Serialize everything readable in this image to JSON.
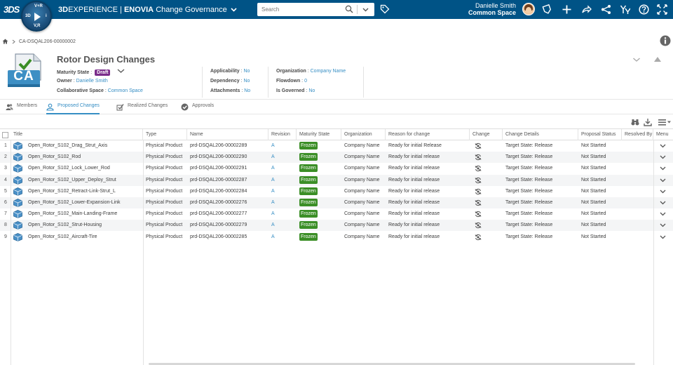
{
  "topbar": {
    "brand": "3DS",
    "compass_labels": {
      "top": "V+R",
      "left": "3D",
      "right": "i",
      "bottom": "V,R"
    },
    "app_title_prefix": "3D",
    "app_title_experience": "EXPERIENCE | ",
    "app_title_enovia": "ENOVIA",
    "app_title_suffix": " Change Governance",
    "search_placeholder": "Search",
    "user_name": "Danielle Smith",
    "user_space": "Common Space"
  },
  "breadcrumb": {
    "path": "CA-DSQAL206-00000002"
  },
  "header": {
    "icon_text": "CA",
    "title": "Rotor Design Changes",
    "maturity_label": "Maturity State",
    "maturity_value": "Draft",
    "owner_label": "Owner",
    "owner_value": "Danielle Smith",
    "collab_label": "Collaborative Space",
    "collab_value": "Common Space",
    "applicability_label": "Applicability",
    "applicability_value": "No",
    "dependency_label": "Dependency",
    "dependency_value": "No",
    "attachments_label": "Attachments",
    "attachments_value": "No",
    "organization_label": "Organization",
    "organization_value": "Company Name",
    "flowdown_label": "Flowdown",
    "flowdown_value": "0",
    "governed_label": "Is Governed",
    "governed_value": "No",
    "sep": " : "
  },
  "tabs": [
    {
      "label": "Members",
      "icon": "members-icon"
    },
    {
      "label": "Proposed Changes",
      "icon": "proposed-changes-icon",
      "active": true
    },
    {
      "label": "Realized Changes",
      "icon": "realized-changes-icon"
    },
    {
      "label": "Approvals",
      "icon": "approvals-icon"
    }
  ],
  "table": {
    "columns": [
      "Title",
      "Type",
      "Name",
      "Revision",
      "Maturity State",
      "Organization",
      "Reason for change",
      "Change",
      "Change Details",
      "Proposal Status",
      "Resolved By",
      "Menu"
    ],
    "rows": [
      {
        "num": "1",
        "title": "Open_Rotor_S102_Drag_Strut_Axis",
        "type": "Physical Product",
        "name": "prd-DSQAL206-00002289",
        "revision": "A",
        "state": "Frozen",
        "org": "Company Name",
        "reason": "Ready for initial Release",
        "details": "Target State: Release",
        "status": "Not Started"
      },
      {
        "num": "2",
        "title": "Open_Rotor_S102_Rod",
        "type": "Physical Product",
        "name": "prd-DSQAL206-00002290",
        "revision": "A",
        "state": "Frozen",
        "org": "Company Name",
        "reason": "Ready for initial release",
        "details": "Target State: Release",
        "status": "Not Started"
      },
      {
        "num": "3",
        "title": "Open_Rotor_S102_Lock_Lower_Rod",
        "type": "Physical Product",
        "name": "prd-DSQAL206-00002291",
        "revision": "A",
        "state": "Frozen",
        "org": "Company Name",
        "reason": "Ready for initial release",
        "details": "Target State: Release",
        "status": "Not Started"
      },
      {
        "num": "4",
        "title": "Open_Rotor_S102_Upper_Deploy_Strut",
        "type": "Physical Product",
        "name": "prd-DSQAL206-00002287",
        "revision": "A",
        "state": "Frozen",
        "org": "Company Name",
        "reason": "Ready for initial release",
        "details": "Target State: Release",
        "status": "Not Started"
      },
      {
        "num": "5",
        "title": "Open_Rotor_S102_Retract-Link-Strut_L",
        "type": "Physical Product",
        "name": "prd-DSQAL206-00002284",
        "revision": "A",
        "state": "Frozen",
        "org": "Company Name",
        "reason": "Ready for initial release",
        "details": "Target State: Release",
        "status": "Not Started"
      },
      {
        "num": "6",
        "title": "Open_Rotor_S102_Lower-Expansion-Link",
        "type": "Physical Product",
        "name": "prd-DSQAL206-00002276",
        "revision": "A",
        "state": "Frozen",
        "org": "Company Name",
        "reason": "Ready for initial release",
        "details": "Target State: Release",
        "status": "Not Started"
      },
      {
        "num": "7",
        "title": "Open_Rotor_S102_Main-Landing-Frame",
        "type": "Physical Product",
        "name": "prd-DSQAL206-00002277",
        "revision": "A",
        "state": "Frozen",
        "org": "Company Name",
        "reason": "Ready for initial release",
        "details": "Target State: Release",
        "status": "Not Started"
      },
      {
        "num": "8",
        "title": "Open_Rotor_S102_Strut-Housing",
        "type": "Physical Product",
        "name": "prd-DSQAL206-00002279",
        "revision": "A",
        "state": "Frozen",
        "org": "Company Name",
        "reason": "Ready for initial release",
        "details": "Target State: Release",
        "status": "Not Started"
      },
      {
        "num": "9",
        "title": "Open_Rotor_S102_Aircraft-Tire",
        "type": "Physical Product",
        "name": "prd-DSQAL206-00002285",
        "revision": "A",
        "state": "Frozen",
        "org": "Company Name",
        "reason": "Ready for initial release",
        "details": "Target State: Release",
        "status": "Not Started"
      }
    ]
  },
  "colors": {
    "topbar": "#005386",
    "link": "#368ec4",
    "frozen": "#3b8e26",
    "draft": "#7a2d8a"
  }
}
